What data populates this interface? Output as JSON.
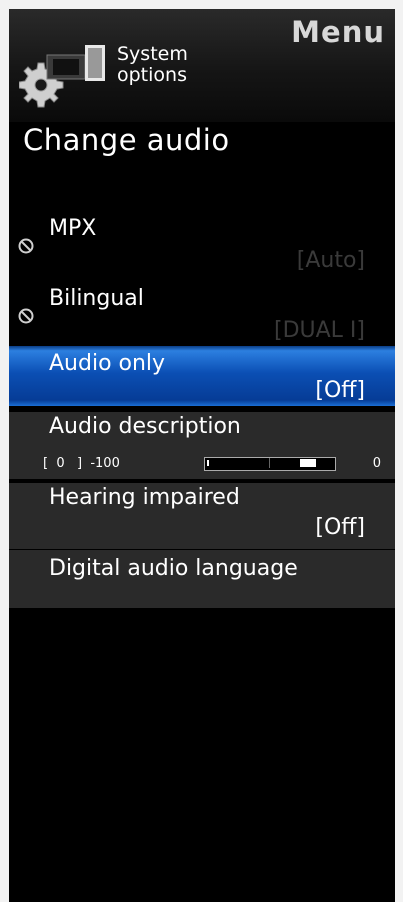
{
  "header": {
    "title": "Menu",
    "category_line1": "System",
    "category_line2": "options",
    "category_icon": "gear-icon"
  },
  "section_title": "Change audio",
  "items": [
    {
      "label": "MPX",
      "value": "[Auto]",
      "state": "disabled"
    },
    {
      "label": "Bilingual",
      "value": "[DUAL I]",
      "state": "disabled"
    },
    {
      "label": "Audio only",
      "value": "[Off]",
      "state": "selected"
    },
    {
      "label": "Audio description",
      "scale_text": "[  0   ]  -100",
      "scale_max": "0",
      "level": 0.88
    },
    {
      "label": "Hearing impaired",
      "value": "[Off]"
    },
    {
      "label": "Digital audio language"
    }
  ],
  "colors": {
    "background": "#000000",
    "selected": "#1f66cc",
    "disabled_value": "#3a3a3a"
  }
}
